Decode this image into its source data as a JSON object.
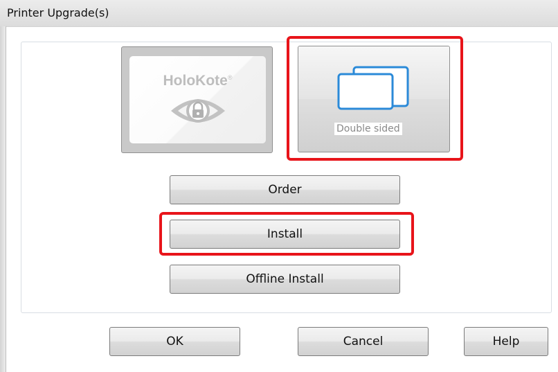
{
  "window": {
    "title": "Printer Upgrade(s)"
  },
  "upgrades": {
    "holokote": {
      "logo_text": "HoloKote",
      "trademark": "®",
      "icon": "eye-lock-icon"
    },
    "double_sided": {
      "label": "Double sided",
      "icon": "stacked-cards-icon"
    }
  },
  "actions": {
    "order_label": "Order",
    "install_label": "Install",
    "offline_install_label": "Offline Install"
  },
  "footer": {
    "ok_label": "OK",
    "cancel_label": "Cancel",
    "help_label": "Help"
  },
  "colors": {
    "highlight": "#e8141a",
    "card_icon": "#2b8ad8"
  }
}
